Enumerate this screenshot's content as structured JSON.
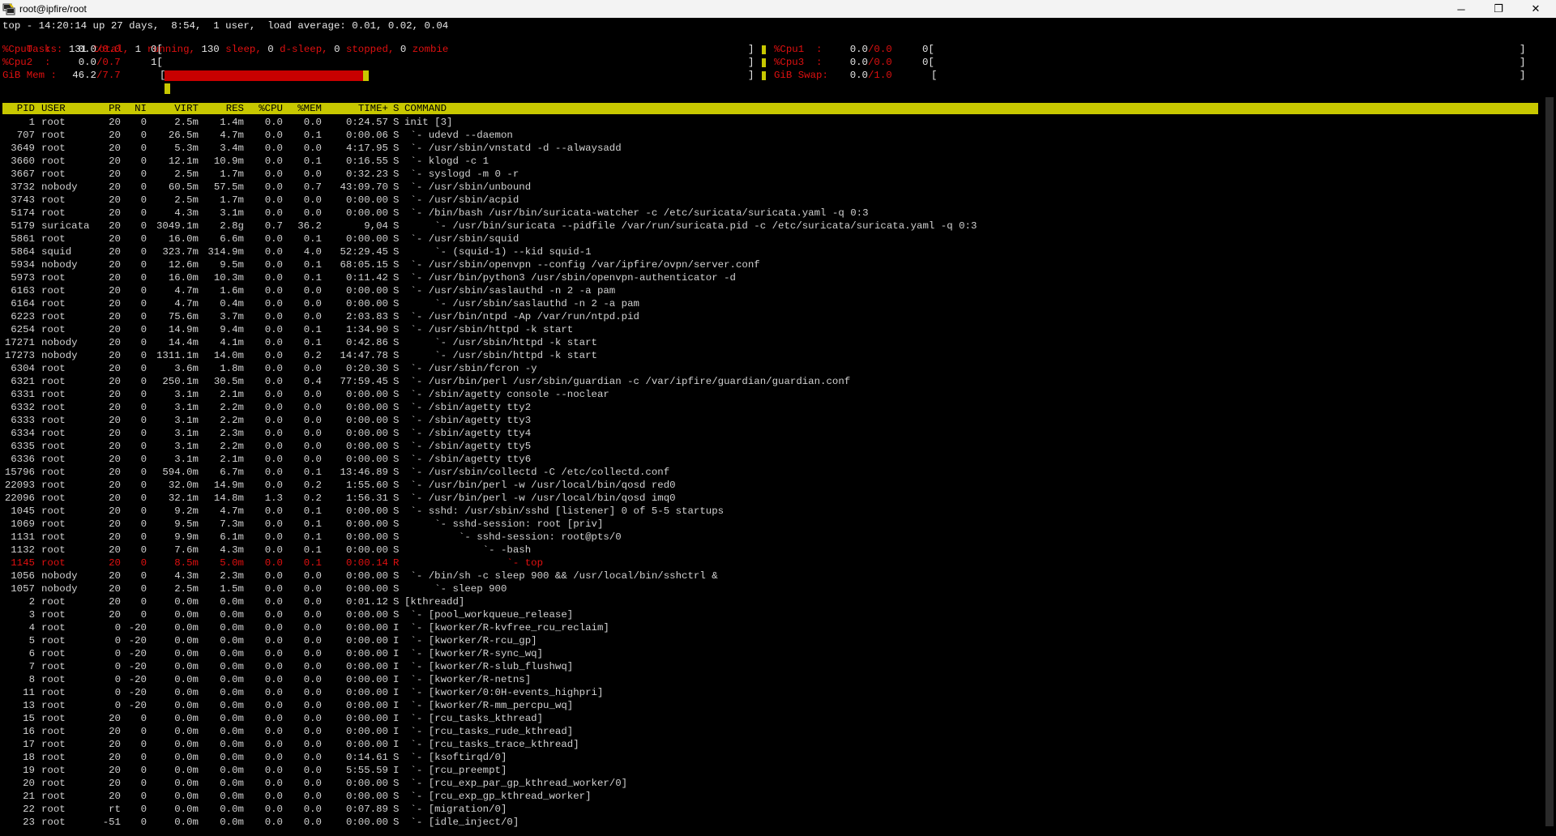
{
  "window": {
    "title": "root@ipfire/root",
    "controls": {
      "minimize": "─",
      "maximize": "❐",
      "close": "✕"
    },
    "icon": "putty-icon"
  },
  "summary": {
    "uptime_line": "top - 14:20:14 up 27 days,  8:54,  1 user,  load average: 0.01, 0.02, 0.04",
    "tasks": {
      "label": "Tasks:",
      "total": "131",
      "total_label": "total,",
      "running": "1",
      "running_label": "running,",
      "sleep": "130",
      "sleep_label": "sleep,",
      "dsleep": "0",
      "dsleep_label": "d-sleep,",
      "stopped": "0",
      "stopped_label": "stopped,",
      "zombie": "0",
      "zombie_label": "zombie"
    },
    "cpu0": {
      "label": "%Cpu0  :",
      "value": "0.0",
      "limit": "/0.0",
      "count": "0[",
      "end": "]"
    },
    "cpu1": {
      "label": "%Cpu1  :",
      "value": "0.0",
      "limit": "/0.0",
      "count": "0[",
      "end": "]"
    },
    "cpu2": {
      "label": "%Cpu2  :",
      "value": "0.0",
      "limit": "/0.7",
      "count": "1[",
      "end": "]"
    },
    "cpu3": {
      "label": "%Cpu3  :",
      "value": "0.0",
      "limit": "/0.0",
      "count": "0[",
      "end": "]"
    },
    "mem": {
      "label": "GiB Mem :",
      "value": "46.2",
      "limit": "/7.7",
      "open": "[",
      "end": "]",
      "fill_fraction": 0.34
    },
    "swap": {
      "label": "GiB Swap:",
      "value": "0.0",
      "limit": "/1.0",
      "open": "[",
      "end": "]"
    }
  },
  "columns": [
    "PID",
    "USER",
    "PR",
    "NI",
    "VIRT",
    "RES",
    "%CPU",
    "%MEM",
    "TIME+",
    "S",
    "COMMAND"
  ],
  "processes": [
    {
      "pid": "1",
      "user": "root",
      "pr": "20",
      "ni": "0",
      "virt": "2.5m",
      "res": "1.4m",
      "cpu": "0.0",
      "mem": "0.0",
      "time": "0:24.57",
      "s": "S",
      "cmd": "init [3]"
    },
    {
      "pid": "707",
      "user": "root",
      "pr": "20",
      "ni": "0",
      "virt": "26.5m",
      "res": "4.7m",
      "cpu": "0.0",
      "mem": "0.1",
      "time": "0:00.06",
      "s": "S",
      "cmd": " `- udevd --daemon"
    },
    {
      "pid": "3649",
      "user": "root",
      "pr": "20",
      "ni": "0",
      "virt": "5.3m",
      "res": "3.4m",
      "cpu": "0.0",
      "mem": "0.0",
      "time": "4:17.95",
      "s": "S",
      "cmd": " `- /usr/sbin/vnstatd -d --alwaysadd"
    },
    {
      "pid": "3660",
      "user": "root",
      "pr": "20",
      "ni": "0",
      "virt": "12.1m",
      "res": "10.9m",
      "cpu": "0.0",
      "mem": "0.1",
      "time": "0:16.55",
      "s": "S",
      "cmd": " `- klogd -c 1"
    },
    {
      "pid": "3667",
      "user": "root",
      "pr": "20",
      "ni": "0",
      "virt": "2.5m",
      "res": "1.7m",
      "cpu": "0.0",
      "mem": "0.0",
      "time": "0:32.23",
      "s": "S",
      "cmd": " `- syslogd -m 0 -r"
    },
    {
      "pid": "3732",
      "user": "nobody",
      "pr": "20",
      "ni": "0",
      "virt": "60.5m",
      "res": "57.5m",
      "cpu": "0.0",
      "mem": "0.7",
      "time": "43:09.70",
      "s": "S",
      "cmd": " `- /usr/sbin/unbound"
    },
    {
      "pid": "3743",
      "user": "root",
      "pr": "20",
      "ni": "0",
      "virt": "2.5m",
      "res": "1.7m",
      "cpu": "0.0",
      "mem": "0.0",
      "time": "0:00.00",
      "s": "S",
      "cmd": " `- /usr/sbin/acpid"
    },
    {
      "pid": "5174",
      "user": "root",
      "pr": "20",
      "ni": "0",
      "virt": "4.3m",
      "res": "3.1m",
      "cpu": "0.0",
      "mem": "0.0",
      "time": "0:00.00",
      "s": "S",
      "cmd": " `- /bin/bash /usr/bin/suricata-watcher -c /etc/suricata/suricata.yaml -q 0:3"
    },
    {
      "pid": "5179",
      "user": "suricata",
      "pr": "20",
      "ni": "0",
      "virt": "3049.1m",
      "res": "2.8g",
      "cpu": "0.7",
      "mem": "36.2",
      "time": "9,04",
      "s": "S",
      "cmd": "     `- /usr/bin/suricata --pidfile /var/run/suricata.pid -c /etc/suricata/suricata.yaml -q 0:3"
    },
    {
      "pid": "5861",
      "user": "root",
      "pr": "20",
      "ni": "0",
      "virt": "16.0m",
      "res": "6.6m",
      "cpu": "0.0",
      "mem": "0.1",
      "time": "0:00.00",
      "s": "S",
      "cmd": " `- /usr/sbin/squid"
    },
    {
      "pid": "5864",
      "user": "squid",
      "pr": "20",
      "ni": "0",
      "virt": "323.7m",
      "res": "314.9m",
      "cpu": "0.0",
      "mem": "4.0",
      "time": "52:29.45",
      "s": "S",
      "cmd": "     `- (squid-1) --kid squid-1"
    },
    {
      "pid": "5934",
      "user": "nobody",
      "pr": "20",
      "ni": "0",
      "virt": "12.6m",
      "res": "9.5m",
      "cpu": "0.0",
      "mem": "0.1",
      "time": "68:05.15",
      "s": "S",
      "cmd": " `- /usr/sbin/openvpn --config /var/ipfire/ovpn/server.conf"
    },
    {
      "pid": "5973",
      "user": "root",
      "pr": "20",
      "ni": "0",
      "virt": "16.0m",
      "res": "10.3m",
      "cpu": "0.0",
      "mem": "0.1",
      "time": "0:11.42",
      "s": "S",
      "cmd": " `- /usr/bin/python3 /usr/sbin/openvpn-authenticator -d"
    },
    {
      "pid": "6163",
      "user": "root",
      "pr": "20",
      "ni": "0",
      "virt": "4.7m",
      "res": "1.6m",
      "cpu": "0.0",
      "mem": "0.0",
      "time": "0:00.00",
      "s": "S",
      "cmd": " `- /usr/sbin/saslauthd -n 2 -a pam"
    },
    {
      "pid": "6164",
      "user": "root",
      "pr": "20",
      "ni": "0",
      "virt": "4.7m",
      "res": "0.4m",
      "cpu": "0.0",
      "mem": "0.0",
      "time": "0:00.00",
      "s": "S",
      "cmd": "     `- /usr/sbin/saslauthd -n 2 -a pam"
    },
    {
      "pid": "6223",
      "user": "root",
      "pr": "20",
      "ni": "0",
      "virt": "75.6m",
      "res": "3.7m",
      "cpu": "0.0",
      "mem": "0.0",
      "time": "2:03.83",
      "s": "S",
      "cmd": " `- /usr/bin/ntpd -Ap /var/run/ntpd.pid"
    },
    {
      "pid": "6254",
      "user": "root",
      "pr": "20",
      "ni": "0",
      "virt": "14.9m",
      "res": "9.4m",
      "cpu": "0.0",
      "mem": "0.1",
      "time": "1:34.90",
      "s": "S",
      "cmd": " `- /usr/sbin/httpd -k start"
    },
    {
      "pid": "17271",
      "user": "nobody",
      "pr": "20",
      "ni": "0",
      "virt": "14.4m",
      "res": "4.1m",
      "cpu": "0.0",
      "mem": "0.1",
      "time": "0:42.86",
      "s": "S",
      "cmd": "     `- /usr/sbin/httpd -k start"
    },
    {
      "pid": "17273",
      "user": "nobody",
      "pr": "20",
      "ni": "0",
      "virt": "1311.1m",
      "res": "14.0m",
      "cpu": "0.0",
      "mem": "0.2",
      "time": "14:47.78",
      "s": "S",
      "cmd": "     `- /usr/sbin/httpd -k start"
    },
    {
      "pid": "6304",
      "user": "root",
      "pr": "20",
      "ni": "0",
      "virt": "3.6m",
      "res": "1.8m",
      "cpu": "0.0",
      "mem": "0.0",
      "time": "0:20.30",
      "s": "S",
      "cmd": " `- /usr/sbin/fcron -y"
    },
    {
      "pid": "6321",
      "user": "root",
      "pr": "20",
      "ni": "0",
      "virt": "250.1m",
      "res": "30.5m",
      "cpu": "0.0",
      "mem": "0.4",
      "time": "77:59.45",
      "s": "S",
      "cmd": " `- /usr/bin/perl /usr/sbin/guardian -c /var/ipfire/guardian/guardian.conf"
    },
    {
      "pid": "6331",
      "user": "root",
      "pr": "20",
      "ni": "0",
      "virt": "3.1m",
      "res": "2.1m",
      "cpu": "0.0",
      "mem": "0.0",
      "time": "0:00.00",
      "s": "S",
      "cmd": " `- /sbin/agetty console --noclear"
    },
    {
      "pid": "6332",
      "user": "root",
      "pr": "20",
      "ni": "0",
      "virt": "3.1m",
      "res": "2.2m",
      "cpu": "0.0",
      "mem": "0.0",
      "time": "0:00.00",
      "s": "S",
      "cmd": " `- /sbin/agetty tty2"
    },
    {
      "pid": "6333",
      "user": "root",
      "pr": "20",
      "ni": "0",
      "virt": "3.1m",
      "res": "2.2m",
      "cpu": "0.0",
      "mem": "0.0",
      "time": "0:00.00",
      "s": "S",
      "cmd": " `- /sbin/agetty tty3"
    },
    {
      "pid": "6334",
      "user": "root",
      "pr": "20",
      "ni": "0",
      "virt": "3.1m",
      "res": "2.3m",
      "cpu": "0.0",
      "mem": "0.0",
      "time": "0:00.00",
      "s": "S",
      "cmd": " `- /sbin/agetty tty4"
    },
    {
      "pid": "6335",
      "user": "root",
      "pr": "20",
      "ni": "0",
      "virt": "3.1m",
      "res": "2.2m",
      "cpu": "0.0",
      "mem": "0.0",
      "time": "0:00.00",
      "s": "S",
      "cmd": " `- /sbin/agetty tty5"
    },
    {
      "pid": "6336",
      "user": "root",
      "pr": "20",
      "ni": "0",
      "virt": "3.1m",
      "res": "2.1m",
      "cpu": "0.0",
      "mem": "0.0",
      "time": "0:00.00",
      "s": "S",
      "cmd": " `- /sbin/agetty tty6"
    },
    {
      "pid": "15796",
      "user": "root",
      "pr": "20",
      "ni": "0",
      "virt": "594.0m",
      "res": "6.7m",
      "cpu": "0.0",
      "mem": "0.1",
      "time": "13:46.89",
      "s": "S",
      "cmd": " `- /usr/sbin/collectd -C /etc/collectd.conf"
    },
    {
      "pid": "22093",
      "user": "root",
      "pr": "20",
      "ni": "0",
      "virt": "32.0m",
      "res": "14.9m",
      "cpu": "0.0",
      "mem": "0.2",
      "time": "1:55.60",
      "s": "S",
      "cmd": " `- /usr/bin/perl -w /usr/local/bin/qosd red0"
    },
    {
      "pid": "22096",
      "user": "root",
      "pr": "20",
      "ni": "0",
      "virt": "32.1m",
      "res": "14.8m",
      "cpu": "1.3",
      "mem": "0.2",
      "time": "1:56.31",
      "s": "S",
      "cmd": " `- /usr/bin/perl -w /usr/local/bin/qosd imq0"
    },
    {
      "pid": "1045",
      "user": "root",
      "pr": "20",
      "ni": "0",
      "virt": "9.2m",
      "res": "4.7m",
      "cpu": "0.0",
      "mem": "0.1",
      "time": "0:00.00",
      "s": "S",
      "cmd": " `- sshd: /usr/sbin/sshd [listener] 0 of 5-5 startups"
    },
    {
      "pid": "1069",
      "user": "root",
      "pr": "20",
      "ni": "0",
      "virt": "9.5m",
      "res": "7.3m",
      "cpu": "0.0",
      "mem": "0.1",
      "time": "0:00.00",
      "s": "S",
      "cmd": "     `- sshd-session: root [priv]"
    },
    {
      "pid": "1131",
      "user": "root",
      "pr": "20",
      "ni": "0",
      "virt": "9.9m",
      "res": "6.1m",
      "cpu": "0.0",
      "mem": "0.1",
      "time": "0:00.00",
      "s": "S",
      "cmd": "         `- sshd-session: root@pts/0"
    },
    {
      "pid": "1132",
      "user": "root",
      "pr": "20",
      "ni": "0",
      "virt": "7.6m",
      "res": "4.3m",
      "cpu": "0.0",
      "mem": "0.1",
      "time": "0:00.00",
      "s": "S",
      "cmd": "             `- -bash"
    },
    {
      "pid": "1145",
      "user": "root",
      "pr": "20",
      "ni": "0",
      "virt": "8.5m",
      "res": "5.0m",
      "cpu": "0.0",
      "mem": "0.1",
      "time": "0:00.14",
      "s": "R",
      "cmd": "                 `- top",
      "current": true
    },
    {
      "pid": "1056",
      "user": "nobody",
      "pr": "20",
      "ni": "0",
      "virt": "4.3m",
      "res": "2.3m",
      "cpu": "0.0",
      "mem": "0.0",
      "time": "0:00.00",
      "s": "S",
      "cmd": " `- /bin/sh -c sleep 900 && /usr/local/bin/sshctrl &"
    },
    {
      "pid": "1057",
      "user": "nobody",
      "pr": "20",
      "ni": "0",
      "virt": "2.5m",
      "res": "1.5m",
      "cpu": "0.0",
      "mem": "0.0",
      "time": "0:00.00",
      "s": "S",
      "cmd": "     `- sleep 900"
    },
    {
      "pid": "2",
      "user": "root",
      "pr": "20",
      "ni": "0",
      "virt": "0.0m",
      "res": "0.0m",
      "cpu": "0.0",
      "mem": "0.0",
      "time": "0:01.12",
      "s": "S",
      "cmd": "[kthreadd]"
    },
    {
      "pid": "3",
      "user": "root",
      "pr": "20",
      "ni": "0",
      "virt": "0.0m",
      "res": "0.0m",
      "cpu": "0.0",
      "mem": "0.0",
      "time": "0:00.00",
      "s": "S",
      "cmd": " `- [pool_workqueue_release]"
    },
    {
      "pid": "4",
      "user": "root",
      "pr": "0",
      "ni": "-20",
      "virt": "0.0m",
      "res": "0.0m",
      "cpu": "0.0",
      "mem": "0.0",
      "time": "0:00.00",
      "s": "I",
      "cmd": " `- [kworker/R-kvfree_rcu_reclaim]"
    },
    {
      "pid": "5",
      "user": "root",
      "pr": "0",
      "ni": "-20",
      "virt": "0.0m",
      "res": "0.0m",
      "cpu": "0.0",
      "mem": "0.0",
      "time": "0:00.00",
      "s": "I",
      "cmd": " `- [kworker/R-rcu_gp]"
    },
    {
      "pid": "6",
      "user": "root",
      "pr": "0",
      "ni": "-20",
      "virt": "0.0m",
      "res": "0.0m",
      "cpu": "0.0",
      "mem": "0.0",
      "time": "0:00.00",
      "s": "I",
      "cmd": " `- [kworker/R-sync_wq]"
    },
    {
      "pid": "7",
      "user": "root",
      "pr": "0",
      "ni": "-20",
      "virt": "0.0m",
      "res": "0.0m",
      "cpu": "0.0",
      "mem": "0.0",
      "time": "0:00.00",
      "s": "I",
      "cmd": " `- [kworker/R-slub_flushwq]"
    },
    {
      "pid": "8",
      "user": "root",
      "pr": "0",
      "ni": "-20",
      "virt": "0.0m",
      "res": "0.0m",
      "cpu": "0.0",
      "mem": "0.0",
      "time": "0:00.00",
      "s": "I",
      "cmd": " `- [kworker/R-netns]"
    },
    {
      "pid": "11",
      "user": "root",
      "pr": "0",
      "ni": "-20",
      "virt": "0.0m",
      "res": "0.0m",
      "cpu": "0.0",
      "mem": "0.0",
      "time": "0:00.00",
      "s": "I",
      "cmd": " `- [kworker/0:0H-events_highpri]"
    },
    {
      "pid": "13",
      "user": "root",
      "pr": "0",
      "ni": "-20",
      "virt": "0.0m",
      "res": "0.0m",
      "cpu": "0.0",
      "mem": "0.0",
      "time": "0:00.00",
      "s": "I",
      "cmd": " `- [kworker/R-mm_percpu_wq]"
    },
    {
      "pid": "15",
      "user": "root",
      "pr": "20",
      "ni": "0",
      "virt": "0.0m",
      "res": "0.0m",
      "cpu": "0.0",
      "mem": "0.0",
      "time": "0:00.00",
      "s": "I",
      "cmd": " `- [rcu_tasks_kthread]"
    },
    {
      "pid": "16",
      "user": "root",
      "pr": "20",
      "ni": "0",
      "virt": "0.0m",
      "res": "0.0m",
      "cpu": "0.0",
      "mem": "0.0",
      "time": "0:00.00",
      "s": "I",
      "cmd": " `- [rcu_tasks_rude_kthread]"
    },
    {
      "pid": "17",
      "user": "root",
      "pr": "20",
      "ni": "0",
      "virt": "0.0m",
      "res": "0.0m",
      "cpu": "0.0",
      "mem": "0.0",
      "time": "0:00.00",
      "s": "I",
      "cmd": " `- [rcu_tasks_trace_kthread]"
    },
    {
      "pid": "18",
      "user": "root",
      "pr": "20",
      "ni": "0",
      "virt": "0.0m",
      "res": "0.0m",
      "cpu": "0.0",
      "mem": "0.0",
      "time": "0:14.61",
      "s": "S",
      "cmd": " `- [ksoftirqd/0]"
    },
    {
      "pid": "19",
      "user": "root",
      "pr": "20",
      "ni": "0",
      "virt": "0.0m",
      "res": "0.0m",
      "cpu": "0.0",
      "mem": "0.0",
      "time": "5:55.59",
      "s": "I",
      "cmd": " `- [rcu_preempt]"
    },
    {
      "pid": "20",
      "user": "root",
      "pr": "20",
      "ni": "0",
      "virt": "0.0m",
      "res": "0.0m",
      "cpu": "0.0",
      "mem": "0.0",
      "time": "0:00.00",
      "s": "S",
      "cmd": " `- [rcu_exp_par_gp_kthread_worker/0]"
    },
    {
      "pid": "21",
      "user": "root",
      "pr": "20",
      "ni": "0",
      "virt": "0.0m",
      "res": "0.0m",
      "cpu": "0.0",
      "mem": "0.0",
      "time": "0:00.00",
      "s": "S",
      "cmd": " `- [rcu_exp_gp_kthread_worker]"
    },
    {
      "pid": "22",
      "user": "root",
      "pr": "rt",
      "ni": "0",
      "virt": "0.0m",
      "res": "0.0m",
      "cpu": "0.0",
      "mem": "0.0",
      "time": "0:07.89",
      "s": "S",
      "cmd": " `- [migration/0]"
    },
    {
      "pid": "23",
      "user": "root",
      "pr": "-51",
      "ni": "0",
      "virt": "0.0m",
      "res": "0.0m",
      "cpu": "0.0",
      "mem": "0.0",
      "time": "0:00.00",
      "s": "S",
      "cmd": " `- [idle_inject/0]"
    }
  ]
}
